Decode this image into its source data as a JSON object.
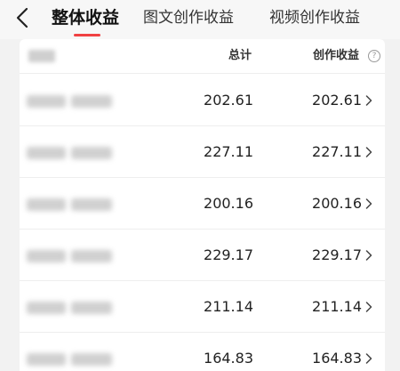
{
  "header": {
    "tabs": [
      {
        "label": "整体收益",
        "active": true
      },
      {
        "label": "图文创作收益",
        "active": false
      },
      {
        "label": "视频创作收益",
        "active": false
      }
    ],
    "accent_color": "#f04142",
    "back_icon": "chevron-left-icon"
  },
  "table": {
    "columns": {
      "total": "总计",
      "income": "创作收益"
    },
    "help_icon": "question-circle-icon",
    "help_glyph": "?",
    "rows": [
      {
        "total": "202.61",
        "income": "202.61"
      },
      {
        "total": "227.11",
        "income": "227.11"
      },
      {
        "total": "200.16",
        "income": "200.16"
      },
      {
        "total": "229.17",
        "income": "229.17"
      },
      {
        "total": "211.14",
        "income": "211.14"
      },
      {
        "total": "164.83",
        "income": "164.83"
      }
    ]
  }
}
